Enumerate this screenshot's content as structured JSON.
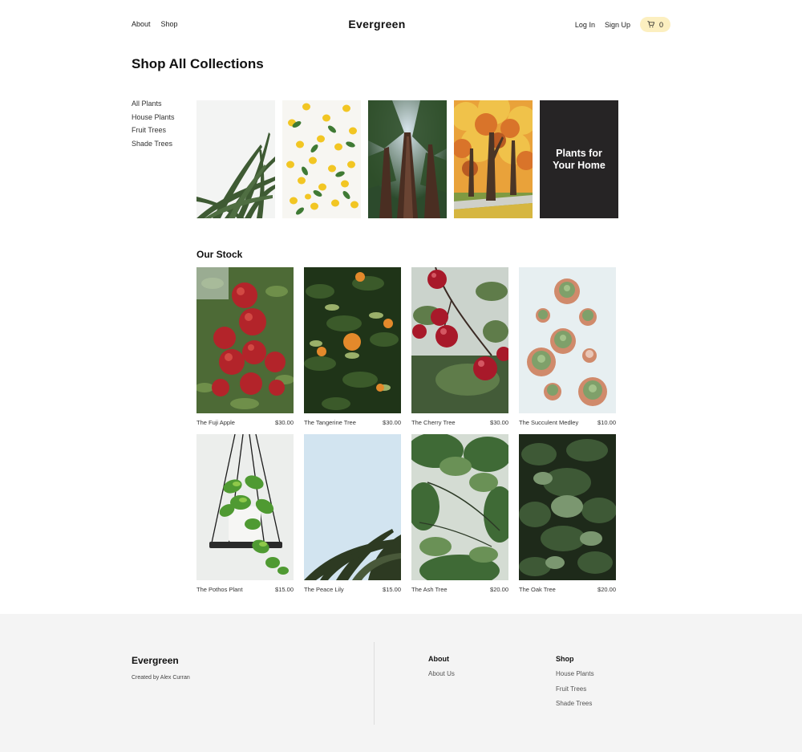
{
  "header": {
    "nav_left": [
      "About",
      "Shop"
    ],
    "logo": "Evergreen",
    "login": "Log In",
    "signup": "Sign Up",
    "cart_count": "0"
  },
  "page_title": "Shop All Collections",
  "sidebar": [
    "All Plants",
    "House Plants",
    "Fruit Trees",
    "Shade Trees"
  ],
  "collections": {
    "feature_line1": "Plants for",
    "feature_line2": "Your Home"
  },
  "stock": {
    "title": "Our Stock",
    "products": [
      {
        "name": "The Fuji Apple",
        "price": "$30.00"
      },
      {
        "name": "The Tangerine Tree",
        "price": "$30.00"
      },
      {
        "name": "The Cherry Tree",
        "price": "$30.00"
      },
      {
        "name": "The Succulent Medley",
        "price": "$10.00"
      },
      {
        "name": "The Pothos Plant",
        "price": "$15.00"
      },
      {
        "name": "The Peace Lily",
        "price": "$15.00"
      },
      {
        "name": "The Ash Tree",
        "price": "$20.00"
      },
      {
        "name": "The Oak Tree",
        "price": "$20.00"
      }
    ]
  },
  "footer": {
    "brand": "Evergreen",
    "credit": "Created by Alex Curran",
    "about_heading": "About",
    "about_links": [
      "About Us"
    ],
    "shop_heading": "Shop",
    "shop_links": [
      "House Plants",
      "Fruit Trees",
      "Shade Trees"
    ]
  },
  "colors": {
    "cart_badge": "#fcefc0",
    "feature_tile": "#262425",
    "footer_bg": "#f4f4f4"
  }
}
